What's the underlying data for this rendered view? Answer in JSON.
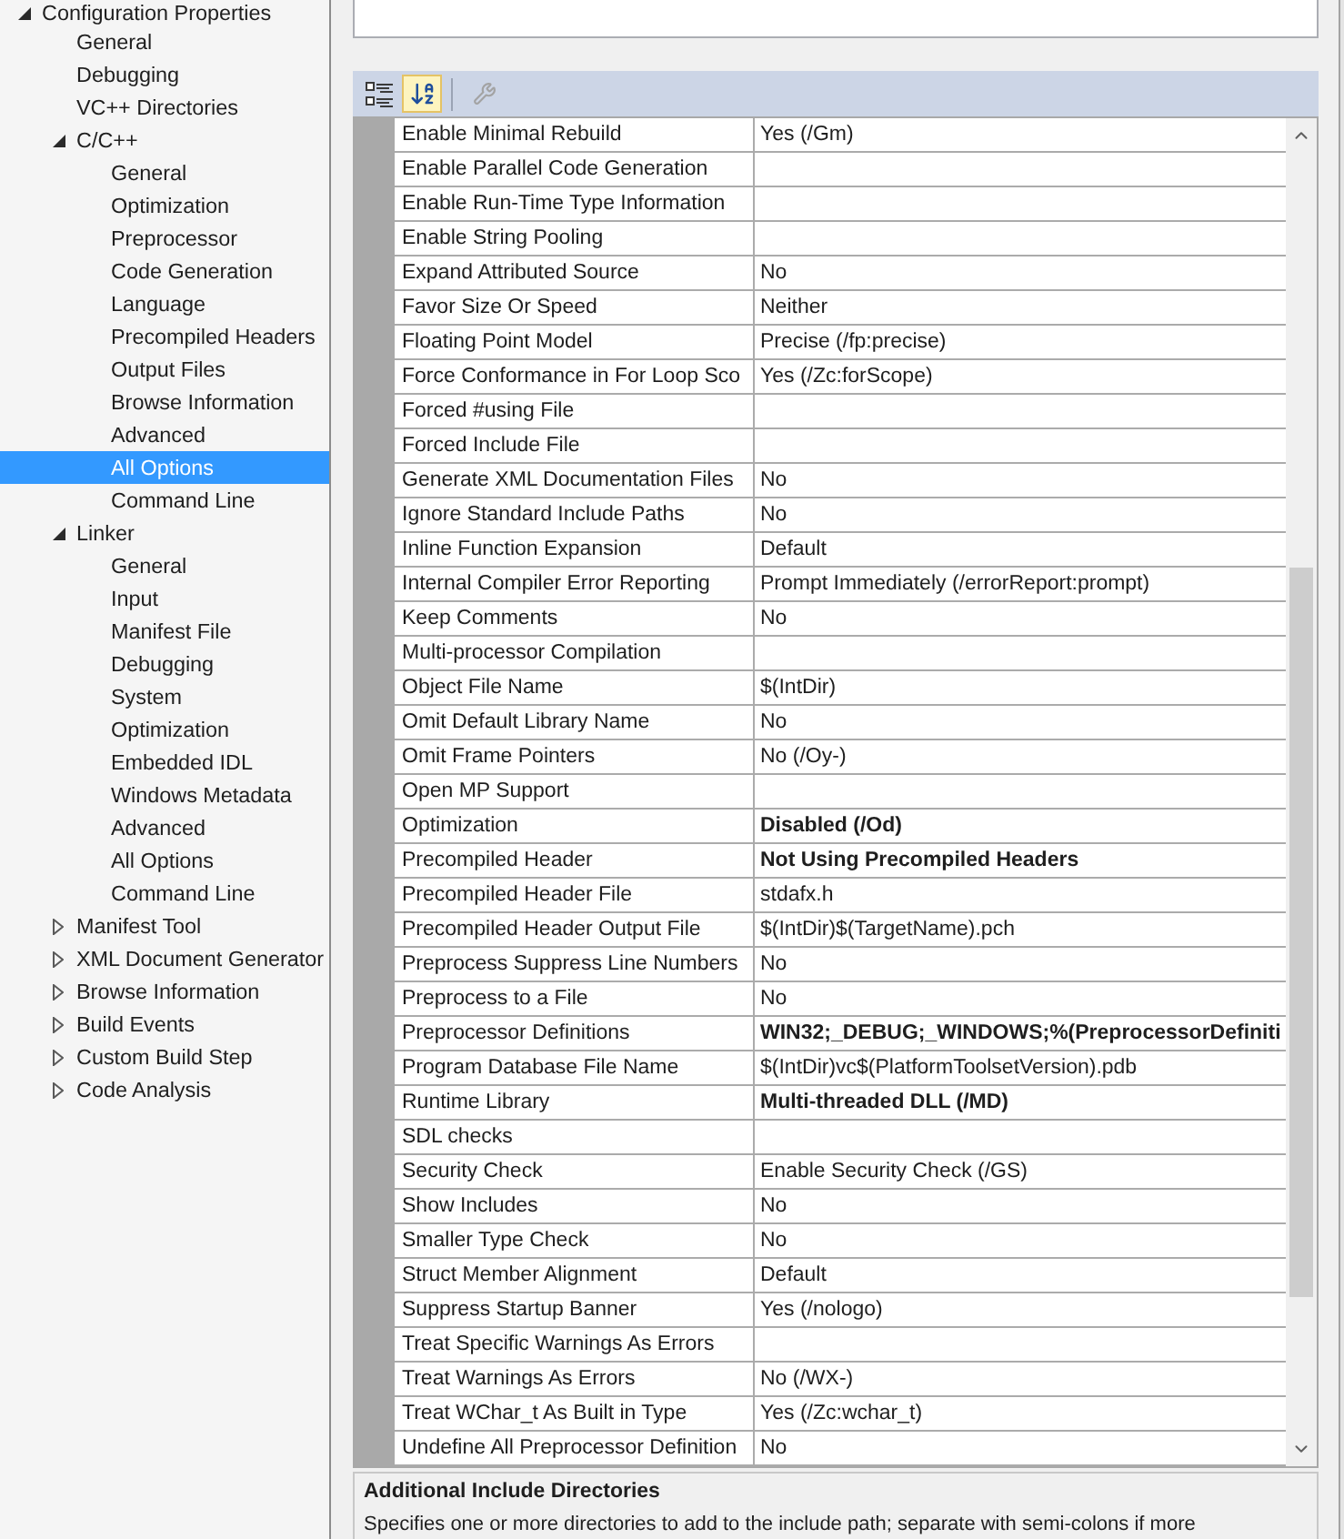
{
  "tree": [
    {
      "label": "Configuration Properties",
      "kind": "group",
      "expanded": true,
      "selected": false,
      "children": [
        {
          "label": "General",
          "kind": "page",
          "selected": false
        },
        {
          "label": "Debugging",
          "kind": "page",
          "selected": false
        },
        {
          "label": "VC++ Directories",
          "kind": "page",
          "selected": false
        },
        {
          "label": "C/C++",
          "kind": "group",
          "expanded": true,
          "selected": false,
          "children": [
            {
              "label": "General",
              "kind": "page",
              "selected": false
            },
            {
              "label": "Optimization",
              "kind": "page",
              "selected": false
            },
            {
              "label": "Preprocessor",
              "kind": "page",
              "selected": false
            },
            {
              "label": "Code Generation",
              "kind": "page",
              "selected": false
            },
            {
              "label": "Language",
              "kind": "page",
              "selected": false
            },
            {
              "label": "Precompiled Headers",
              "kind": "page",
              "selected": false
            },
            {
              "label": "Output Files",
              "kind": "page",
              "selected": false
            },
            {
              "label": "Browse Information",
              "kind": "page",
              "selected": false
            },
            {
              "label": "Advanced",
              "kind": "page",
              "selected": false
            },
            {
              "label": "All Options",
              "kind": "page",
              "selected": true
            },
            {
              "label": "Command Line",
              "kind": "page",
              "selected": false
            }
          ]
        },
        {
          "label": "Linker",
          "kind": "group",
          "expanded": true,
          "selected": false,
          "children": [
            {
              "label": "General",
              "kind": "page",
              "selected": false
            },
            {
              "label": "Input",
              "kind": "page",
              "selected": false
            },
            {
              "label": "Manifest File",
              "kind": "page",
              "selected": false
            },
            {
              "label": "Debugging",
              "kind": "page",
              "selected": false
            },
            {
              "label": "System",
              "kind": "page",
              "selected": false
            },
            {
              "label": "Optimization",
              "kind": "page",
              "selected": false
            },
            {
              "label": "Embedded IDL",
              "kind": "page",
              "selected": false
            },
            {
              "label": "Windows Metadata",
              "kind": "page",
              "selected": false
            },
            {
              "label": "Advanced",
              "kind": "page",
              "selected": false
            },
            {
              "label": "All Options",
              "kind": "page",
              "selected": false
            },
            {
              "label": "Command Line",
              "kind": "page",
              "selected": false
            }
          ]
        },
        {
          "label": "Manifest Tool",
          "kind": "group",
          "expanded": false,
          "selected": false
        },
        {
          "label": "XML Document Generator",
          "kind": "group",
          "expanded": false,
          "selected": false
        },
        {
          "label": "Browse Information",
          "kind": "group",
          "expanded": false,
          "selected": false
        },
        {
          "label": "Build Events",
          "kind": "group",
          "expanded": false,
          "selected": false
        },
        {
          "label": "Custom Build Step",
          "kind": "group",
          "expanded": false,
          "selected": false
        },
        {
          "label": "Code Analysis",
          "kind": "group",
          "expanded": false,
          "selected": false
        }
      ]
    }
  ],
  "toolbar": {
    "view_buttons": [
      {
        "selected": false
      },
      {
        "selected": true
      }
    ],
    "pages_button": {
      "disabled": true
    }
  },
  "properties": [
    {
      "name": "Enable Minimal Rebuild",
      "value": "Yes (/Gm)",
      "modified": false
    },
    {
      "name": "Enable Parallel Code Generation"
    },
    {
      "name": "Enable Run-Time Type Information"
    },
    {
      "name": "Enable String Pooling"
    },
    {
      "name": "Expand Attributed Source",
      "value": "No",
      "modified": false
    },
    {
      "name": "Favor Size Or Speed",
      "value": "Neither",
      "modified": false
    },
    {
      "name": "Floating Point Model",
      "value": "Precise (/fp:precise)",
      "modified": false
    },
    {
      "name": "Force Conformance in For Loop Sco",
      "value": "Yes (/Zc:forScope)",
      "modified": false
    },
    {
      "name": "Forced #using File"
    },
    {
      "name": "Forced Include File"
    },
    {
      "name": "Generate XML Documentation Files",
      "value": "No",
      "modified": false
    },
    {
      "name": "Ignore Standard Include Paths",
      "value": "No",
      "modified": false
    },
    {
      "name": "Inline Function Expansion",
      "value": "Default",
      "modified": false
    },
    {
      "name": "Internal Compiler Error Reporting",
      "value": "Prompt Immediately (/errorReport:prompt)",
      "modified": false
    },
    {
      "name": "Keep Comments",
      "value": "No",
      "modified": false
    },
    {
      "name": "Multi-processor Compilation"
    },
    {
      "name": "Object File Name",
      "value": "$(IntDir)",
      "modified": false
    },
    {
      "name": "Omit Default Library Name",
      "value": "No",
      "modified": false
    },
    {
      "name": "Omit Frame Pointers",
      "value": "No (/Oy-)",
      "modified": false
    },
    {
      "name": "Open MP Support"
    },
    {
      "name": "Optimization",
      "value": "Disabled (/Od)",
      "modified": true
    },
    {
      "name": "Precompiled Header",
      "value": "Not Using Precompiled Headers",
      "modified": true
    },
    {
      "name": "Precompiled Header File",
      "value": "stdafx.h",
      "modified": false
    },
    {
      "name": "Precompiled Header Output File",
      "value": "$(IntDir)$(TargetName).pch",
      "modified": false
    },
    {
      "name": "Preprocess Suppress Line Numbers",
      "value": "No",
      "modified": false
    },
    {
      "name": "Preprocess to a File",
      "value": "No",
      "modified": false
    },
    {
      "name": "Preprocessor Definitions",
      "value": "WIN32;_DEBUG;_WINDOWS;%(PreprocessorDefiniti",
      "modified": true
    },
    {
      "name": "Program Database File Name",
      "value": "$(IntDir)vc$(PlatformToolsetVersion).pdb",
      "modified": false
    },
    {
      "name": "Runtime Library",
      "value": "Multi-threaded DLL (/MD)",
      "modified": true
    },
    {
      "name": "SDL checks"
    },
    {
      "name": "Security Check",
      "value": "Enable Security Check (/GS)",
      "modified": false
    },
    {
      "name": "Show Includes",
      "value": "No",
      "modified": false
    },
    {
      "name": "Smaller Type Check",
      "value": "No",
      "modified": false
    },
    {
      "name": "Struct Member Alignment",
      "value": "Default",
      "modified": false
    },
    {
      "name": "Suppress Startup Banner",
      "value": "Yes (/nologo)",
      "modified": false
    },
    {
      "name": "Treat Specific Warnings As Errors"
    },
    {
      "name": "Treat Warnings As Errors",
      "value": "No (/WX-)",
      "modified": false
    },
    {
      "name": "Treat WChar_t As Built in Type",
      "value": "Yes (/Zc:wchar_t)",
      "modified": false
    },
    {
      "name": "Undefine All Preprocessor Definition",
      "value": "No",
      "modified": false
    }
  ],
  "description": {
    "title": "Additional Include Directories",
    "text": "Specifies one or more directories to add to the include path; separate with semi-colons if more"
  }
}
